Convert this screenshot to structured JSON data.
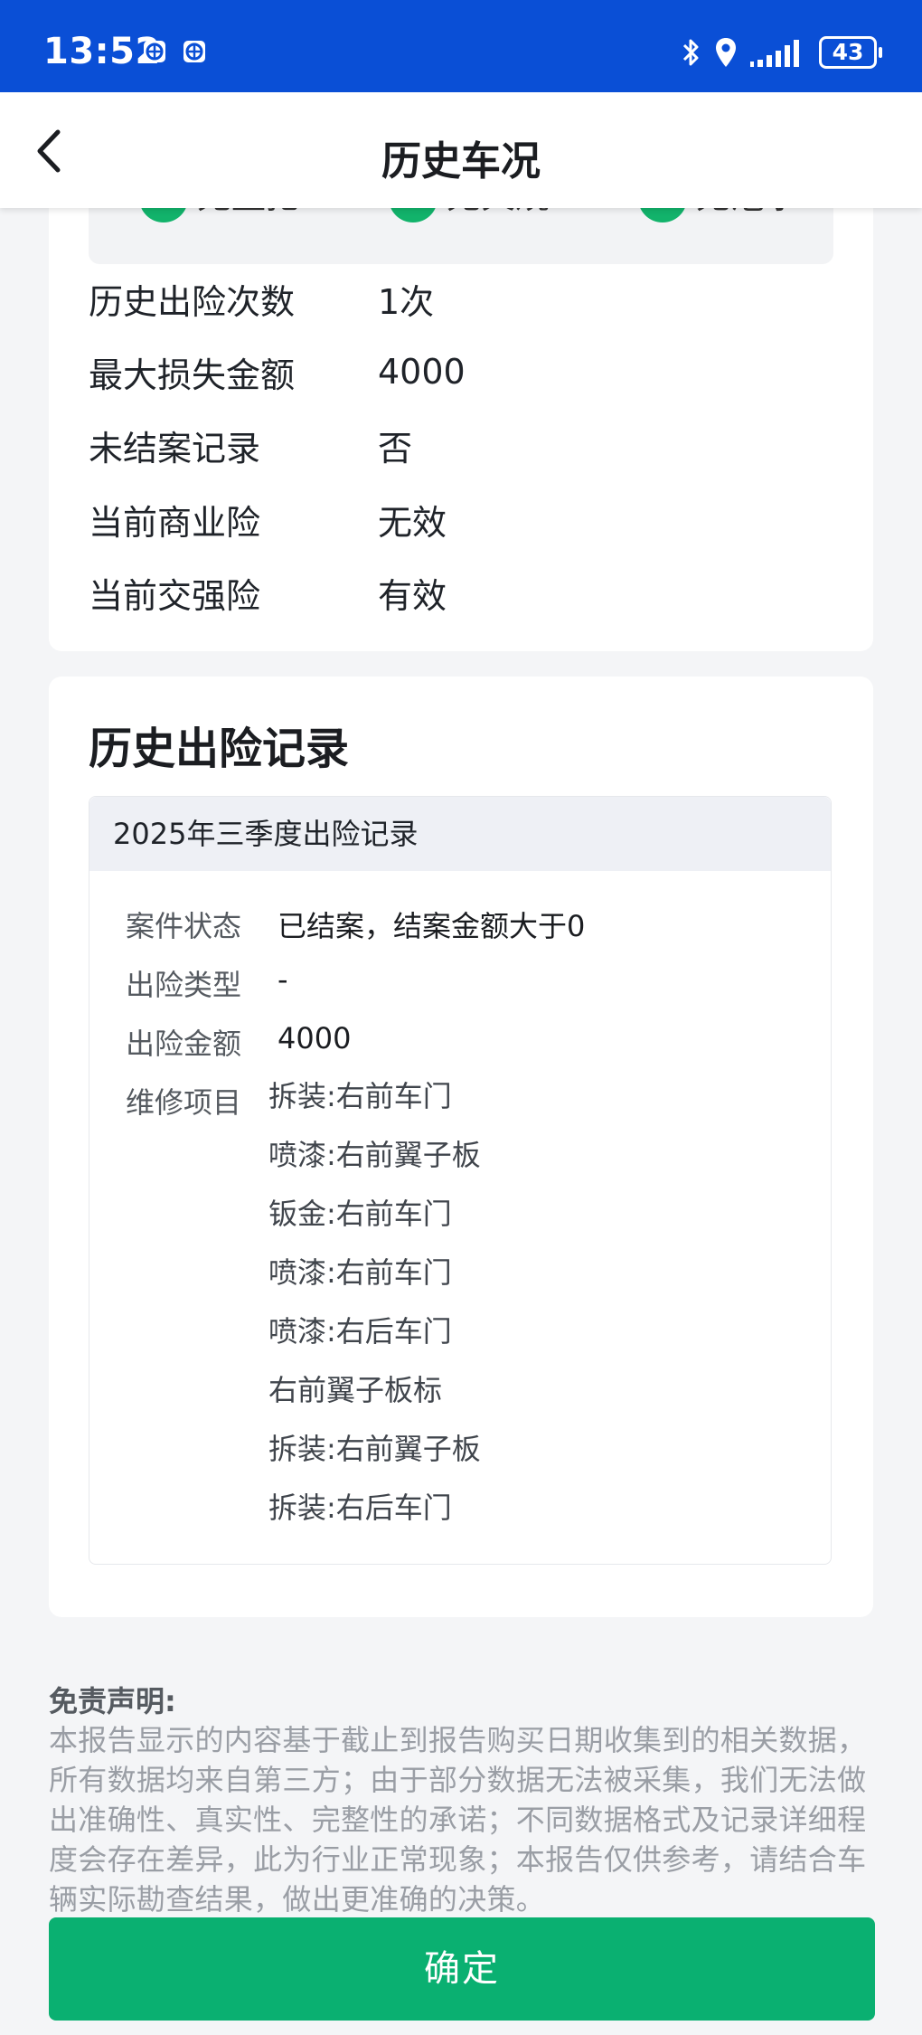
{
  "status_bar": {
    "time": "13:52",
    "battery": "43",
    "icons": [
      "notification-app-icon",
      "notification-app-icon",
      "bluetooth-icon",
      "location-icon",
      "signal-icon",
      "battery-icon"
    ]
  },
  "header": {
    "title": "历史车况"
  },
  "check_strip": {
    "items": [
      "无盗抢",
      "无火烧",
      "无泡水"
    ]
  },
  "summary": {
    "rows": [
      {
        "label": "历史出险次数",
        "value": "1次"
      },
      {
        "label": "最大损失金额",
        "value": "4000"
      },
      {
        "label": "未结案记录",
        "value": "否"
      },
      {
        "label": "当前商业险",
        "value": "无效"
      },
      {
        "label": "当前交强险",
        "value": "有效"
      }
    ]
  },
  "claims": {
    "title": "历史出险记录",
    "record": {
      "period": "2025年三季度出险记录",
      "status_label": "案件状态",
      "status_value": "已结案，结案金额大于0",
      "type_label": "出险类型",
      "type_value": "-",
      "amount_label": "出险金额",
      "amount_value": "4000",
      "repair_label": "维修项目",
      "repair_items": [
        "拆装:右前车门",
        "喷漆:右前翼子板",
        "钣金:右前车门",
        "喷漆:右前车门",
        "喷漆:右后车门",
        "右前翼子板标",
        "拆装:右前翼子板",
        "拆装:右后车门"
      ]
    }
  },
  "disclaimer": {
    "title": "免责声明:",
    "text": "本报告显示的内容基于截止到报告购买日期收集到的相关数据，所有数据均来自第三方；由于部分数据无法被采集，我们无法做出准确性、真实性、完整性的承诺；不同数据格式及记录详细程度会存在差异，此为行业正常现象；本报告仅供参考，请结合车辆实际勘查结果，做出更准确的决策。"
  },
  "actions": {
    "confirm": "确定"
  },
  "colors": {
    "status_bar": "#0a4fd6",
    "accent_green": "#0ab071",
    "check_green": "#12b36b"
  }
}
